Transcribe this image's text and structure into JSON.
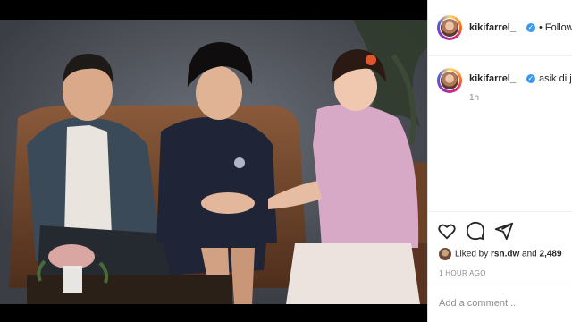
{
  "post": {
    "username": "kikifarrel_",
    "follow_label": "• Following",
    "caption_username": "kikifarrel_",
    "caption_text": "asik di joo",
    "caption_time": "1h",
    "liked_by_prefix": "Liked by ",
    "liked_by_user": "rsn.dw",
    "liked_by_and": " and ",
    "liked_by_count": "2,489",
    "post_time": "1 HOUR AGO",
    "comment_placeholder": "Add a comment..."
  },
  "icons": {
    "verified": "verified-badge-icon",
    "like": "heart-icon",
    "comment": "comment-icon",
    "share": "send-icon"
  },
  "colors": {
    "verified": "#3897f0",
    "text": "#262626",
    "muted": "#8e8e8e",
    "border": "#dbdbdb"
  }
}
